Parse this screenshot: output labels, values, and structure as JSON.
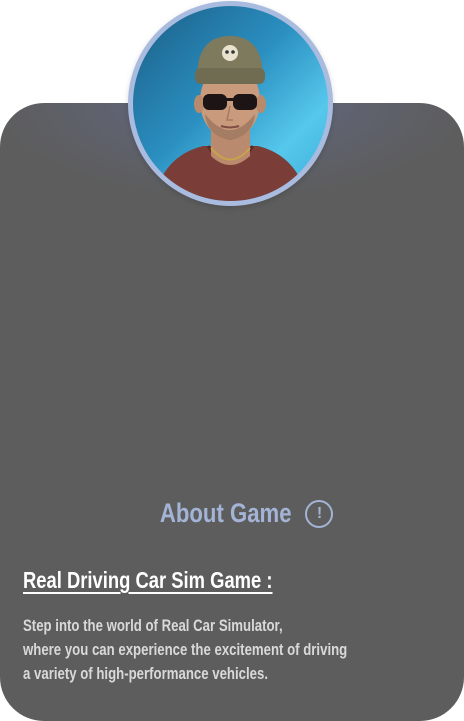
{
  "about": {
    "title": "About Game",
    "info_icon": "info-icon",
    "info_glyph": "!"
  },
  "game": {
    "heading": "Real Driving Car Sim Game :",
    "description_lines": [
      "Step into the world of Real Car Simulator,",
      "where you can experience the excitement of driving",
      "a variety of high-performance vehicles."
    ]
  },
  "colors": {
    "card_background": "#5d5d5d",
    "accent": "#a3b4d6",
    "avatar_ring": "#a9bbdf"
  }
}
